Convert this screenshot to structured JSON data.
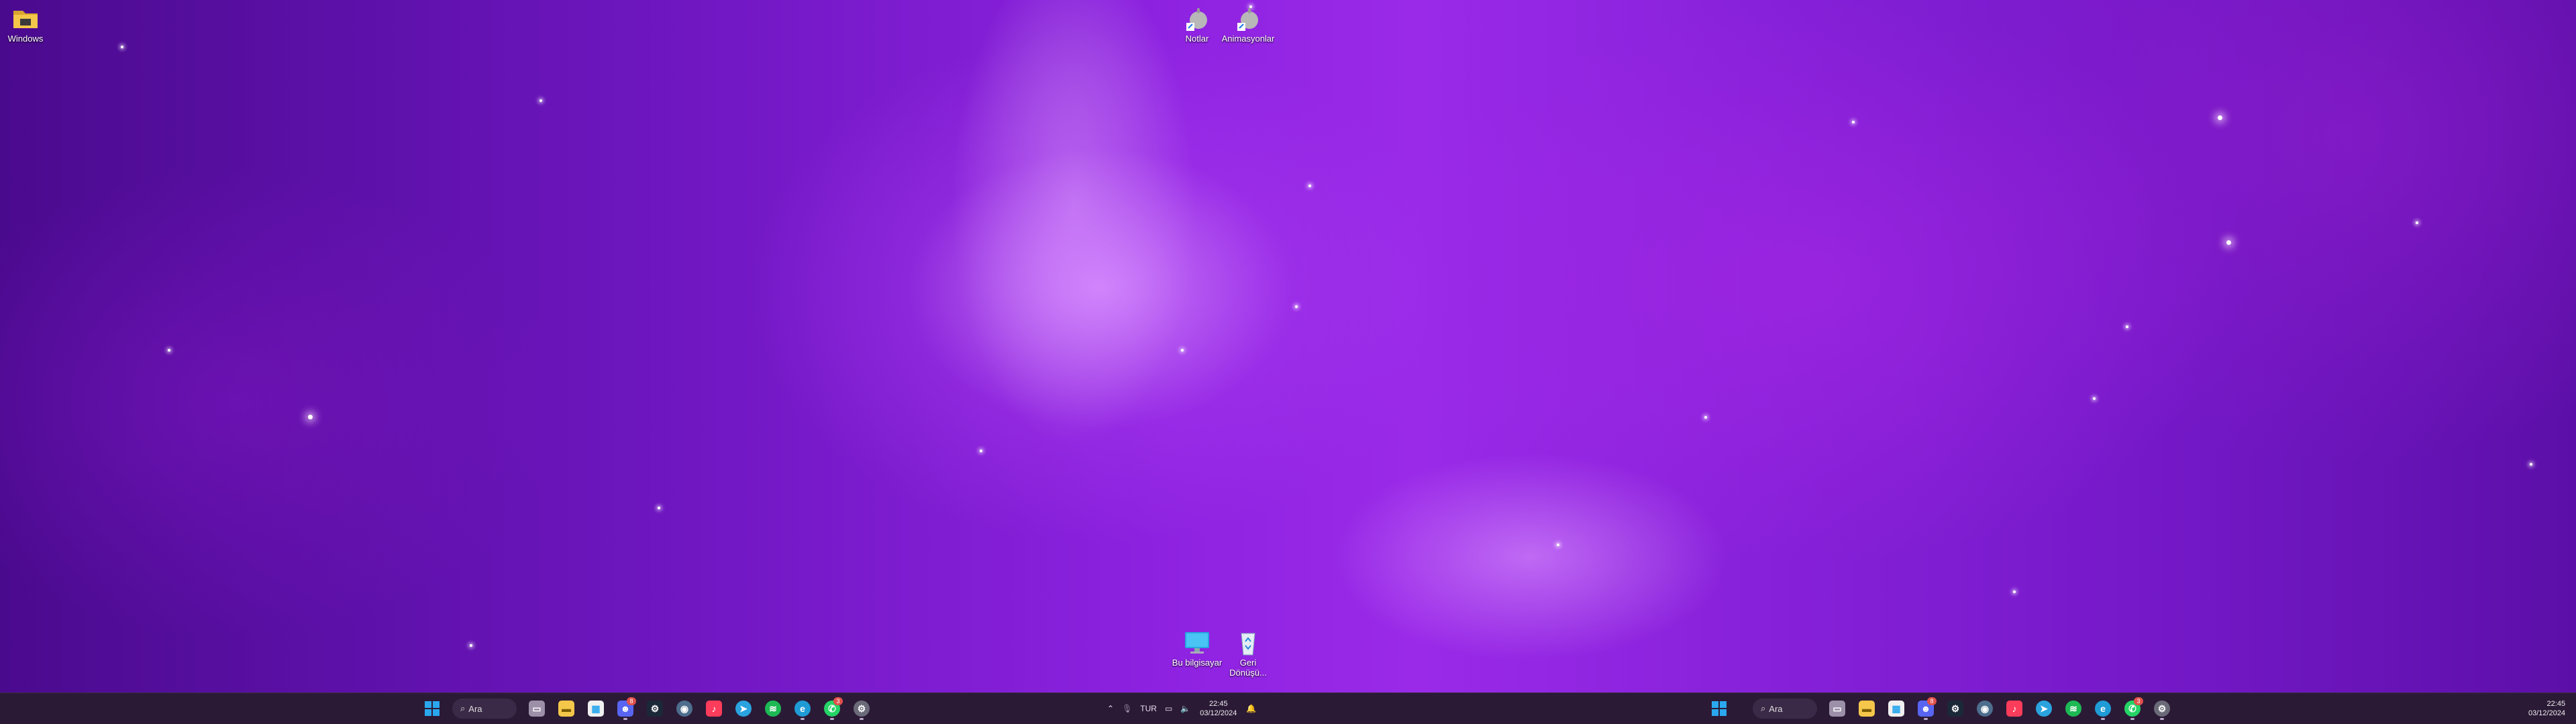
{
  "desktop_icons": {
    "windows_folder": {
      "label": "Windows"
    },
    "notlar": {
      "label": "Notlar"
    },
    "animasyonlar": {
      "label": "Animasyonlar"
    },
    "bu_bilgisayar": {
      "label": "Bu bilgisayar"
    },
    "geri_donusum": {
      "label": "Geri\nDönüşü..."
    }
  },
  "taskbar_left": {
    "search_placeholder": "Ara",
    "apps": [
      {
        "name": "task-view-icon",
        "badge": ""
      },
      {
        "name": "file-explorer-icon",
        "badge": ""
      },
      {
        "name": "microsoft-store-icon",
        "badge": ""
      },
      {
        "name": "discord-icon",
        "badge": "8"
      },
      {
        "name": "steam-icon",
        "badge": ""
      },
      {
        "name": "app-icon",
        "badge": ""
      },
      {
        "name": "itunes-icon",
        "badge": ""
      },
      {
        "name": "telegram-icon",
        "badge": ""
      },
      {
        "name": "spotify-icon",
        "badge": ""
      },
      {
        "name": "edge-icon",
        "badge": ""
      },
      {
        "name": "whatsapp-icon",
        "badge": "3"
      },
      {
        "name": "settings-icon",
        "badge": ""
      }
    ],
    "tray": {
      "language": "TUR",
      "time": "22:45",
      "date": "03/12/2024"
    }
  },
  "taskbar_right": {
    "search_placeholder": "Ara",
    "tray": {
      "time": "22:45",
      "date": "03/12/2024"
    }
  },
  "colors": {
    "taskbar": "#2b1a36",
    "discord": "#5865f2",
    "steam": "#1b2838",
    "spotify": "#1db954",
    "whatsapp": "#25d366",
    "telegram": "#2aa3df",
    "itunes": "#fb3c5a",
    "edge": "#1f9bd6",
    "folder": "#f4c64a",
    "windows_logo": "#2aa7ee"
  }
}
